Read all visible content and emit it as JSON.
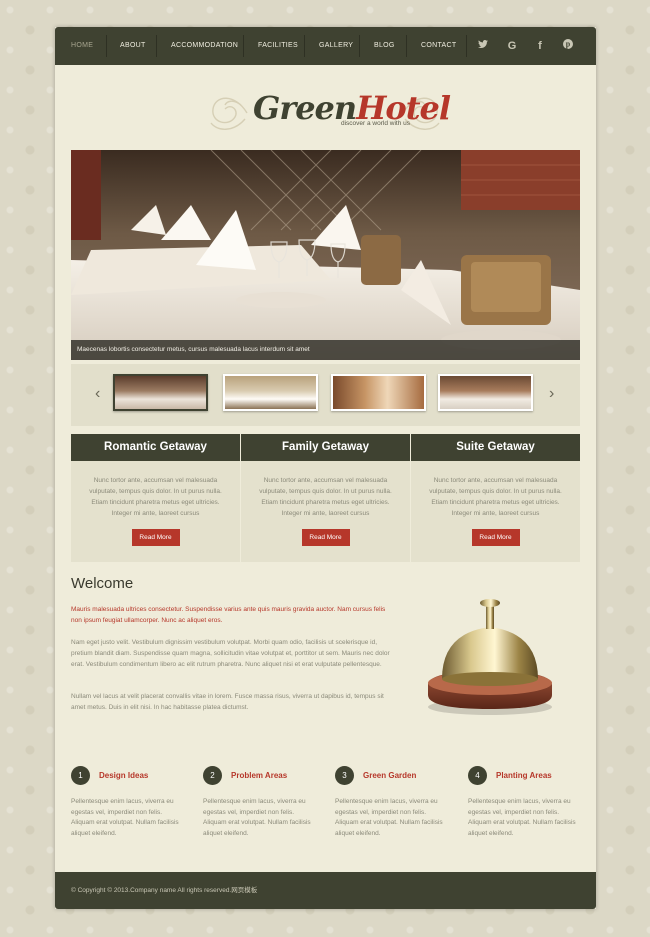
{
  "nav": {
    "items": [
      "HOME",
      "ABOUT",
      "ACCOMMODATION",
      "FACILITIES",
      "GALLERY",
      "BLOG",
      "CONTACT"
    ],
    "social": [
      {
        "name": "twitter-icon",
        "glyph": "🐦"
      },
      {
        "name": "google-icon",
        "glyph": "G"
      },
      {
        "name": "facebook-icon",
        "glyph": "f"
      },
      {
        "name": "pinterest-icon",
        "glyph": "℗"
      }
    ]
  },
  "logo": {
    "part1": "Green",
    "part2": "Hotel",
    "tagline": "discover a world with us"
  },
  "slider": {
    "caption": "Maecenas lobortis consectetur metus, cursus malesuada lacus interdum sit amet",
    "prev": "‹",
    "next": "›"
  },
  "features": [
    {
      "title": "Romantic Getaway",
      "text": "Nunc tortor ante, accumsan vel malesuada vulputate, tempus quis dolor. In ut purus nulla. Etiam tincidunt pharetra metus eget ultricies. Integer mi ante, laoreet cursus",
      "button": "Read More"
    },
    {
      "title": "Family Getaway",
      "text": "Nunc tortor ante, accumsan vel malesuada vulputate, tempus quis dolor. In ut purus nulla. Etiam tincidunt pharetra metus eget ultricies. Integer mi ante, laoreet cursus",
      "button": "Read More"
    },
    {
      "title": "Suite Getaway",
      "text": "Nunc tortor ante, accumsan vel malesuada vulputate, tempus quis dolor. In ut purus nulla. Etiam tincidunt pharetra metus eget ultricies. Integer mi ante, laoreet cursus",
      "button": "Read More"
    }
  ],
  "welcome": {
    "title": "Welcome",
    "lead": "Mauris malesuada ultrices consectetur. Suspendisse varius ante quis mauris gravida auctor. Nam cursus felis non ipsum feugiat ullamcorper. Nunc ac aliquet eros.",
    "p1": "Nam eget justo velit. Vestibulum dignissim vestibulum volutpat. Morbi quam odio, facilisis ut scelerisque id, pretium blandit diam. Suspendisse quam magna, sollicitudin vitae volutpat et, porttitor ut sem. Mauris nec dolor erat. Vestibulum condimentum libero ac elit rutrum pharetra. Nunc aliquet nisi et erat vulputate pellentesque.",
    "p2": "Nullam vel lacus at velit placerat convallis vitae in lorem. Fusce massa risus, viverra ut dapibus id, tempus sit amet metus. Duis in elit nisi. In hac habitasse platea dictumst."
  },
  "steps": [
    {
      "num": "1",
      "title": "Design Ideas",
      "text": "Pellentesque enim lacus, viverra eu egestas vel, imperdiet non felis. Aliquam erat volutpat. Nullam facilisis aliquet eleifend."
    },
    {
      "num": "2",
      "title": "Problem Areas",
      "text": "Pellentesque enim lacus, viverra eu egestas vel, imperdiet non felis. Aliquam erat volutpat. Nullam facilisis aliquet eleifend."
    },
    {
      "num": "3",
      "title": "Green Garden",
      "text": "Pellentesque enim lacus, viverra eu egestas vel, imperdiet non felis. Aliquam erat volutpat. Nullam facilisis aliquet eleifend."
    },
    {
      "num": "4",
      "title": "Planting Areas",
      "text": "Pellentesque enim lacus, viverra eu egestas vel, imperdiet non felis. Aliquam erat volutpat. Nullam facilisis aliquet eleifend."
    }
  ],
  "footer": {
    "copyright": "© Copyright © 2013.Company name All rights reserved.网页模板"
  },
  "colors": {
    "dark": "#3f4231",
    "accent": "#b6372a",
    "page": "#efecda"
  }
}
